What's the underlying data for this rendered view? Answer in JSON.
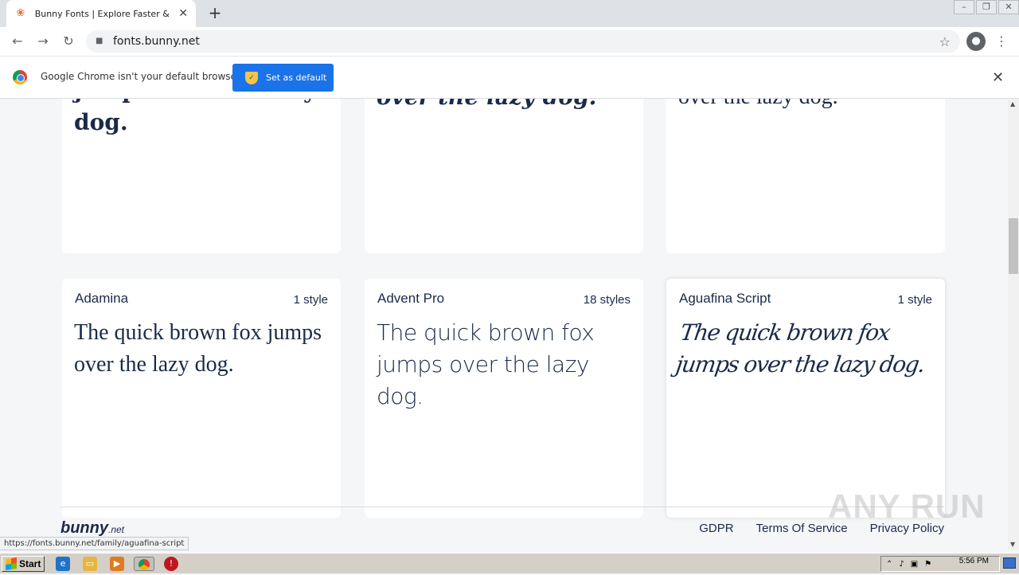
{
  "browser": {
    "tab_title": "Bunny Fonts | Explore Faster & GDPR",
    "tab_close": "✕",
    "new_tab": "+",
    "url": "fonts.bunny.net",
    "back": "←",
    "forward": "→",
    "reload": "↻",
    "bookmark_star": "☆",
    "menu": "⋮",
    "window_controls": [
      "–",
      "❐",
      "✕"
    ]
  },
  "infobar": {
    "message": "Google Chrome isn't your default browser",
    "button_label": "Set as default",
    "close": "✕"
  },
  "top_row": [
    {
      "sample": "jumps over the lazy dog."
    },
    {
      "sample": "over the lazy dog."
    },
    {
      "sample": "over the lazy dog."
    }
  ],
  "fonts": [
    {
      "name": "Adamina",
      "styles": "1 style",
      "sample": "The quick brown fox jumps over the lazy dog."
    },
    {
      "name": "Advent Pro",
      "styles": "18 styles",
      "sample": "The quick brown fox jumps over the lazy dog."
    },
    {
      "name": "Aguafina Script",
      "styles": "1 style",
      "sample": "The quick brown fox jumps over the lazy dog."
    }
  ],
  "footer": {
    "logo": "bunny",
    "logo_suffix": ".net",
    "links": [
      "GDPR",
      "Terms Of Service",
      "Privacy Policy"
    ]
  },
  "watermark": "ANY RUN",
  "status_url": "https://fonts.bunny.net/family/aguafina-script",
  "taskbar": {
    "start_label": "Start",
    "clock": "5:56 PM"
  }
}
